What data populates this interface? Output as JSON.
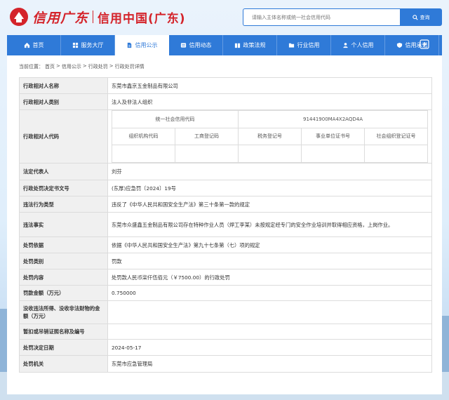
{
  "header": {
    "logo_script": "信用广东",
    "logo_name": "信用中国(广东)",
    "search_placeholder": "请输入主体名称或统一社会信用代码",
    "search_button": "查询"
  },
  "nav": {
    "items": [
      {
        "label": "首页",
        "icon": "home-icon"
      },
      {
        "label": "服务大厅",
        "icon": "grid-icon"
      },
      {
        "label": "信用公示",
        "icon": "document-icon",
        "active": true
      },
      {
        "label": "信用动态",
        "icon": "news-icon"
      },
      {
        "label": "政策法规",
        "icon": "book-icon"
      },
      {
        "label": "行业信用",
        "icon": "folder-icon"
      },
      {
        "label": "个人信用",
        "icon": "person-icon"
      },
      {
        "label": "信用承诺",
        "icon": "shield-icon"
      }
    ],
    "extra_icon": "expand-icon"
  },
  "breadcrumb": {
    "prefix": "当前位置：",
    "items": [
      "首页",
      "信用公示",
      "行政处罚",
      "行政处罚详情"
    ],
    "separator": ">"
  },
  "detail": {
    "name_label": "行政相对人名称",
    "name_value": "东莞市鑫京五金制品有限公司",
    "type_label": "行政相对人类别",
    "type_value": "法人及非法人组织",
    "code_label": "行政相对人代码",
    "uscc_header": "统一社会信用代码",
    "uscc_value": "91441900MA4X2AQD4A",
    "sub_headers": [
      "组织机构代码",
      "工商登记码",
      "税务登记号",
      "事业单位证书号",
      "社会组织登记证号"
    ],
    "legal_rep_label": "法定代表人",
    "legal_rep_value": "刘芬",
    "doc_no_label": "行政处罚决定书文号",
    "doc_no_value": "(东厚)应急罚〔2024〕19号",
    "violation_type_label": "违法行为类型",
    "violation_type_value": "违反了《中华人民共和国安全生产法》第三十条第一款的规定",
    "facts_label": "违法事实",
    "facts_value": "东莞市众盛鑫五金制品有限公司存在特种作业人员（焊工李某）未按规定经专门的安全作业培训并取得相应资格，上岗作业。",
    "basis_label": "处罚依据",
    "basis_value": "依据《中华人民共和国安全生产法》第九十七条第（七）项的规定",
    "category_label": "处罚类别",
    "category_value": "罚款",
    "content_label": "处罚内容",
    "content_value": "处罚款人民币柒仟伍佰元（￥7500.00）的行政处罚",
    "amount_label": "罚款金额（万元）",
    "amount_value": "0.750000",
    "confiscation_label": "没收违法所得、没收非法财物的金额（万元）",
    "confiscation_value": "",
    "license_label": "暂扣或吊销证照名称及编号",
    "license_value": "",
    "date_label": "处罚决定日期",
    "date_value": "2024-05-17",
    "authority_label": "处罚机关",
    "authority_value": "东莞市应急管理局"
  }
}
